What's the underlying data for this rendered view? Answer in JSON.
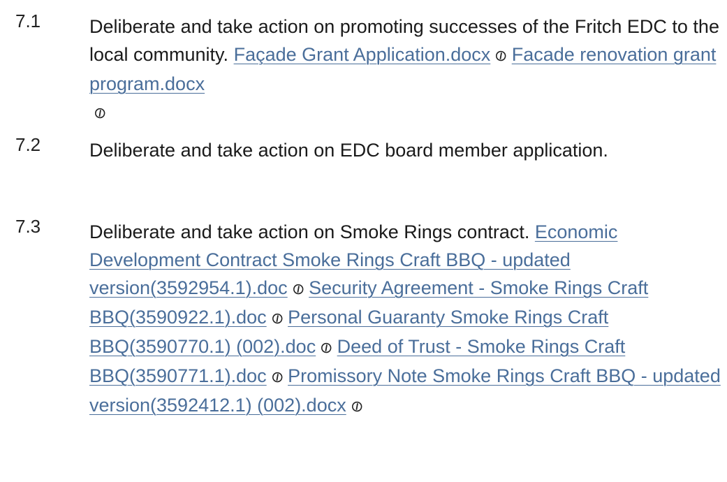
{
  "items": [
    {
      "number": "7.1",
      "text": "Deliberate and take action on promoting successes of the Fritch EDC to the local community.",
      "attachments": [
        {
          "label": "Façade Grant Application.docx",
          "icon": "paperclip-icon"
        },
        {
          "label": "Facade renovation grant program.docx",
          "icon": "paperclip-icon"
        }
      ]
    },
    {
      "number": "7.2",
      "text": "Deliberate and take action on EDC board member application.",
      "attachments": []
    },
    {
      "number": "7.3",
      "text": "Deliberate and take action on Smoke Rings contract.",
      "attachments": [
        {
          "label": "Economic Development Contract Smoke Rings Craft BBQ - updated version(3592954.1).doc",
          "icon": "paperclip-icon"
        },
        {
          "label": "Security Agreement - Smoke Rings Craft BBQ(3590922.1).doc",
          "icon": "paperclip-icon"
        },
        {
          "label": "Personal Guaranty Smoke Rings Craft BBQ(3590770.1) (002).doc",
          "icon": "paperclip-icon"
        },
        {
          "label": "Deed of Trust - Smoke Rings Craft BBQ(3590771.1).doc",
          "icon": "paperclip-icon"
        },
        {
          "label": "Promissory Note Smoke Rings Craft BBQ - updated version(3592412.1) (002).docx",
          "icon": "paperclip-icon"
        }
      ]
    }
  ],
  "colors": {
    "link": "#4a6e9a",
    "text": "#1a1a1a"
  }
}
